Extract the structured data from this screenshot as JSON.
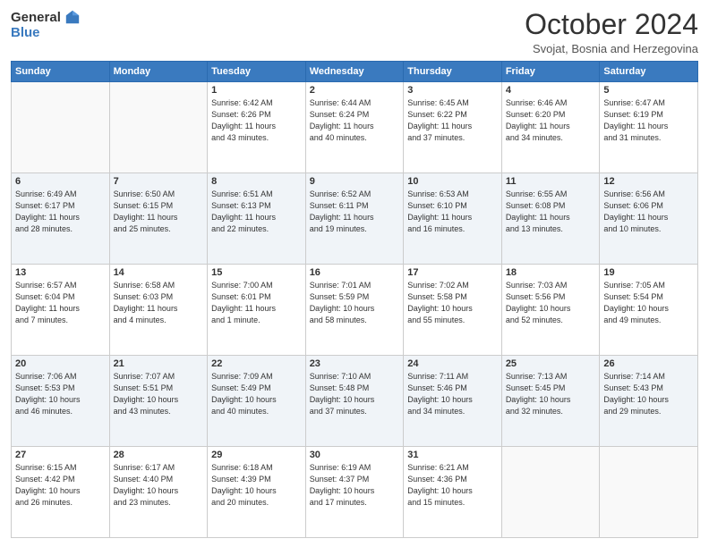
{
  "logo": {
    "general": "General",
    "blue": "Blue"
  },
  "header": {
    "month": "October 2024",
    "location": "Svojat, Bosnia and Herzegovina"
  },
  "weekdays": [
    "Sunday",
    "Monday",
    "Tuesday",
    "Wednesday",
    "Thursday",
    "Friday",
    "Saturday"
  ],
  "weeks": [
    [
      {
        "day": "",
        "info": ""
      },
      {
        "day": "",
        "info": ""
      },
      {
        "day": "1",
        "info": "Sunrise: 6:42 AM\nSunset: 6:26 PM\nDaylight: 11 hours\nand 43 minutes."
      },
      {
        "day": "2",
        "info": "Sunrise: 6:44 AM\nSunset: 6:24 PM\nDaylight: 11 hours\nand 40 minutes."
      },
      {
        "day": "3",
        "info": "Sunrise: 6:45 AM\nSunset: 6:22 PM\nDaylight: 11 hours\nand 37 minutes."
      },
      {
        "day": "4",
        "info": "Sunrise: 6:46 AM\nSunset: 6:20 PM\nDaylight: 11 hours\nand 34 minutes."
      },
      {
        "day": "5",
        "info": "Sunrise: 6:47 AM\nSunset: 6:19 PM\nDaylight: 11 hours\nand 31 minutes."
      }
    ],
    [
      {
        "day": "6",
        "info": "Sunrise: 6:49 AM\nSunset: 6:17 PM\nDaylight: 11 hours\nand 28 minutes."
      },
      {
        "day": "7",
        "info": "Sunrise: 6:50 AM\nSunset: 6:15 PM\nDaylight: 11 hours\nand 25 minutes."
      },
      {
        "day": "8",
        "info": "Sunrise: 6:51 AM\nSunset: 6:13 PM\nDaylight: 11 hours\nand 22 minutes."
      },
      {
        "day": "9",
        "info": "Sunrise: 6:52 AM\nSunset: 6:11 PM\nDaylight: 11 hours\nand 19 minutes."
      },
      {
        "day": "10",
        "info": "Sunrise: 6:53 AM\nSunset: 6:10 PM\nDaylight: 11 hours\nand 16 minutes."
      },
      {
        "day": "11",
        "info": "Sunrise: 6:55 AM\nSunset: 6:08 PM\nDaylight: 11 hours\nand 13 minutes."
      },
      {
        "day": "12",
        "info": "Sunrise: 6:56 AM\nSunset: 6:06 PM\nDaylight: 11 hours\nand 10 minutes."
      }
    ],
    [
      {
        "day": "13",
        "info": "Sunrise: 6:57 AM\nSunset: 6:04 PM\nDaylight: 11 hours\nand 7 minutes."
      },
      {
        "day": "14",
        "info": "Sunrise: 6:58 AM\nSunset: 6:03 PM\nDaylight: 11 hours\nand 4 minutes."
      },
      {
        "day": "15",
        "info": "Sunrise: 7:00 AM\nSunset: 6:01 PM\nDaylight: 11 hours\nand 1 minute."
      },
      {
        "day": "16",
        "info": "Sunrise: 7:01 AM\nSunset: 5:59 PM\nDaylight: 10 hours\nand 58 minutes."
      },
      {
        "day": "17",
        "info": "Sunrise: 7:02 AM\nSunset: 5:58 PM\nDaylight: 10 hours\nand 55 minutes."
      },
      {
        "day": "18",
        "info": "Sunrise: 7:03 AM\nSunset: 5:56 PM\nDaylight: 10 hours\nand 52 minutes."
      },
      {
        "day": "19",
        "info": "Sunrise: 7:05 AM\nSunset: 5:54 PM\nDaylight: 10 hours\nand 49 minutes."
      }
    ],
    [
      {
        "day": "20",
        "info": "Sunrise: 7:06 AM\nSunset: 5:53 PM\nDaylight: 10 hours\nand 46 minutes."
      },
      {
        "day": "21",
        "info": "Sunrise: 7:07 AM\nSunset: 5:51 PM\nDaylight: 10 hours\nand 43 minutes."
      },
      {
        "day": "22",
        "info": "Sunrise: 7:09 AM\nSunset: 5:49 PM\nDaylight: 10 hours\nand 40 minutes."
      },
      {
        "day": "23",
        "info": "Sunrise: 7:10 AM\nSunset: 5:48 PM\nDaylight: 10 hours\nand 37 minutes."
      },
      {
        "day": "24",
        "info": "Sunrise: 7:11 AM\nSunset: 5:46 PM\nDaylight: 10 hours\nand 34 minutes."
      },
      {
        "day": "25",
        "info": "Sunrise: 7:13 AM\nSunset: 5:45 PM\nDaylight: 10 hours\nand 32 minutes."
      },
      {
        "day": "26",
        "info": "Sunrise: 7:14 AM\nSunset: 5:43 PM\nDaylight: 10 hours\nand 29 minutes."
      }
    ],
    [
      {
        "day": "27",
        "info": "Sunrise: 6:15 AM\nSunset: 4:42 PM\nDaylight: 10 hours\nand 26 minutes."
      },
      {
        "day": "28",
        "info": "Sunrise: 6:17 AM\nSunset: 4:40 PM\nDaylight: 10 hours\nand 23 minutes."
      },
      {
        "day": "29",
        "info": "Sunrise: 6:18 AM\nSunset: 4:39 PM\nDaylight: 10 hours\nand 20 minutes."
      },
      {
        "day": "30",
        "info": "Sunrise: 6:19 AM\nSunset: 4:37 PM\nDaylight: 10 hours\nand 17 minutes."
      },
      {
        "day": "31",
        "info": "Sunrise: 6:21 AM\nSunset: 4:36 PM\nDaylight: 10 hours\nand 15 minutes."
      },
      {
        "day": "",
        "info": ""
      },
      {
        "day": "",
        "info": ""
      }
    ]
  ]
}
